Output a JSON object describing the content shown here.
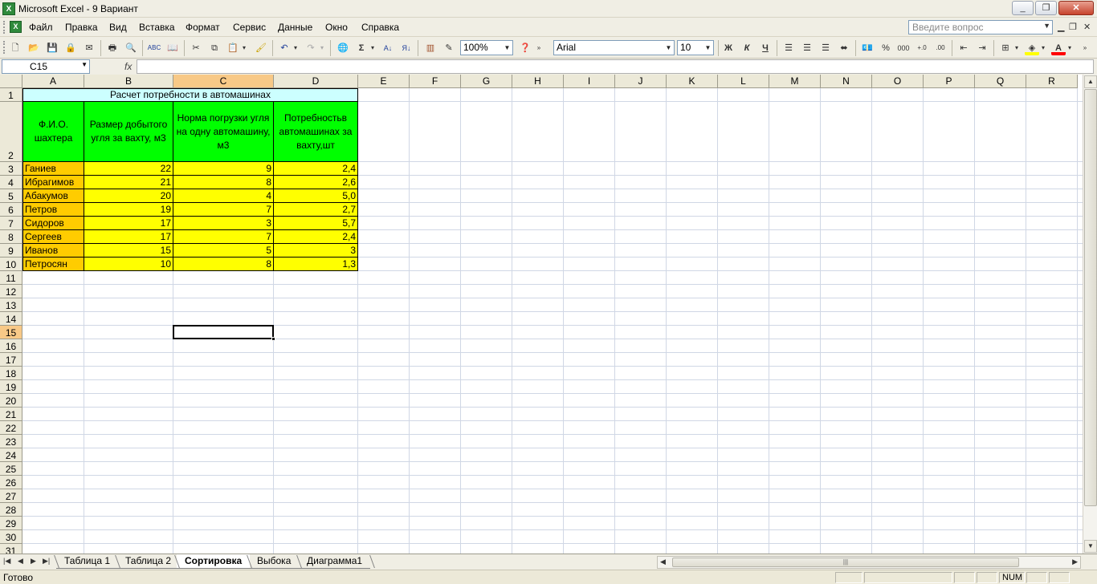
{
  "window": {
    "title": "Microsoft Excel - 9 Вариант",
    "app_icon": "excel-icon",
    "buttons": [
      "minimize-icon",
      "restore-icon",
      "close-icon"
    ]
  },
  "menu": {
    "items": [
      "Файл",
      "Правка",
      "Вид",
      "Вставка",
      "Формат",
      "Сервис",
      "Данные",
      "Окно",
      "Справка"
    ],
    "question_placeholder": "Введите вопрос"
  },
  "toolbar": {
    "zoom": "100%",
    "font_name": "Arial",
    "font_size": "10",
    "bold": "Ж",
    "italic": "К",
    "underline": "Ч",
    "percent": "%",
    "thousands": "000",
    "fill_color": "#ffff00",
    "font_color": "#ff0000"
  },
  "formula_bar": {
    "cell_ref": "C15",
    "fx": "fx",
    "formula": ""
  },
  "sheet": {
    "columns": [
      "A",
      "B",
      "C",
      "D",
      "E",
      "F",
      "G",
      "H",
      "I",
      "J",
      "K",
      "L",
      "M",
      "N",
      "O",
      "P",
      "Q",
      "R"
    ],
    "active_column": "C",
    "active_row": 15,
    "row_count": 32,
    "title": "Расчет потребности в автомашинах",
    "headers": [
      "Ф.И.О. шахтера",
      "Размер добытого угля за вахту, м3",
      "Норма погрузки угля на одну автомашину, м3",
      "Потребностьв автомашинах за вахту,шт"
    ],
    "rows": [
      {
        "name": "Ганиев",
        "mined": "22",
        "norm": "9",
        "need": "2,4"
      },
      {
        "name": "Ибрагимов",
        "mined": "21",
        "norm": "8",
        "need": "2,6"
      },
      {
        "name": "Абакумов",
        "mined": "20",
        "norm": "4",
        "need": "5,0"
      },
      {
        "name": "Петров",
        "mined": "19",
        "norm": "7",
        "need": "2,7"
      },
      {
        "name": "Сидоров",
        "mined": "17",
        "norm": "3",
        "need": "5,7"
      },
      {
        "name": "Сергеев",
        "mined": "17",
        "norm": "7",
        "need": "2,4"
      },
      {
        "name": "Иванов",
        "mined": "15",
        "norm": "5",
        "need": "3"
      },
      {
        "name": "Петросян",
        "mined": "10",
        "norm": "8",
        "need": "1,3"
      }
    ],
    "colors": {
      "title_fill": "#ccffff",
      "header_fill": "#00ff00",
      "name_fill": "#ffcc00",
      "data_fill": "#ffff00"
    }
  },
  "tabs": {
    "items": [
      "Таблица 1",
      "Таблица 2",
      "Сортировка",
      "Выбока",
      "Диаграмма1"
    ],
    "active": "Сортировка"
  },
  "status": {
    "text": "Готово",
    "num": "NUM"
  }
}
